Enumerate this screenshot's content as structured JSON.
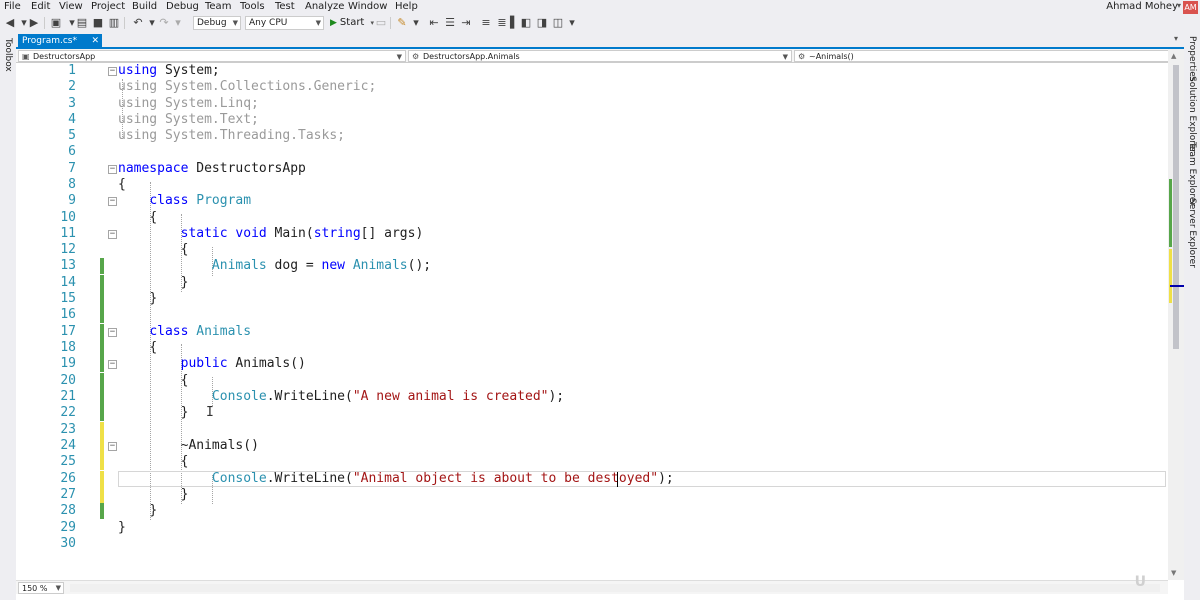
{
  "menu": [
    "File",
    "Edit",
    "View",
    "Project",
    "Build",
    "Debug",
    "Team",
    "Tools",
    "Test",
    "Analyze",
    "Window",
    "Help"
  ],
  "account": {
    "name": "Ahmad Mohey",
    "initials": "AM",
    "avatar_color": "#d9534f"
  },
  "toolbar": {
    "config": "Debug",
    "platform": "Any CPU",
    "start_label": "Start"
  },
  "side_panels": {
    "left": "Toolbox",
    "right": [
      "Properties",
      "Solution Explorer",
      "Team Explorer",
      "Server Explorer"
    ]
  },
  "tab": {
    "label": "Program.cs*",
    "close": "✕"
  },
  "navbar": {
    "project": "DestructorsApp",
    "class": "DestructorsApp.Animals",
    "member": "~Animals()"
  },
  "editor": {
    "zoom": "150 %",
    "accent_color": "#007acc",
    "lines": [
      "1",
      "2",
      "3",
      "4",
      "5",
      "6",
      "7",
      "8",
      "9",
      "10",
      "11",
      "12",
      "13",
      "14",
      "15",
      "16",
      "17",
      "18",
      "19",
      "20",
      "21",
      "22",
      "23",
      "24",
      "25",
      "26",
      "27",
      "28",
      "29",
      "30"
    ],
    "code": {
      "l1_kw": "using",
      "l1_rest": " System;",
      "l2": "using System.Collections.Generic;",
      "l3": "using System.Linq;",
      "l4": "using System.Text;",
      "l5": "using System.Threading.Tasks;",
      "l7_kw": "namespace",
      "l7_rest": " DestructorsApp",
      "l8": "{",
      "l9_kw": "class",
      "l9_ty": "Program",
      "l10": "{",
      "l11_kw1": "static",
      "l11_kw2": "void",
      "l11_name": " Main(",
      "l11_kw3": "string",
      "l11_rest": "[] args)",
      "l12": "{",
      "l13_ty1": "Animals",
      "l13_mid": " dog = ",
      "l13_kw": "new",
      "l13_ty2": "Animals",
      "l13_end": "();",
      "l14": "}",
      "l15": "}",
      "l17_kw": "class",
      "l17_ty": "Animals",
      "l18": "{",
      "l19_kw": "public",
      "l19_rest": " Animals()",
      "l20": "{",
      "l21_ty": "Console",
      "l21_mid": ".WriteLine(",
      "l21_str": "\"A new animal is created\"",
      "l21_end": ");",
      "l22": "}",
      "l24": "~Animals()",
      "l25": "{",
      "l26_ty": "Console",
      "l26_mid": ".WriteLine(",
      "l26_str": "\"Animal object is about to be destoyed\"",
      "l26_end": ");",
      "l27": "}",
      "l28": "}",
      "l29": "}"
    }
  }
}
